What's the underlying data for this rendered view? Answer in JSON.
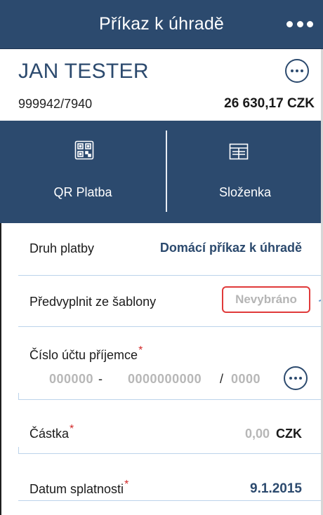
{
  "header": {
    "title": "Příkaz k úhradě",
    "more_icon": "more-horizontal-icon"
  },
  "account": {
    "name": "JAN TESTER",
    "number": "999942/7940",
    "balance": "26 630,17 CZK",
    "options_icon": "more-circle-icon"
  },
  "actions": [
    {
      "label": "QR Platba",
      "icon": "qr-code-icon"
    },
    {
      "label": "Složenka",
      "icon": "payment-slip-icon"
    }
  ],
  "form": {
    "payment_type": {
      "label": "Druh platby",
      "value": "Domácí příkaz k úhradě"
    },
    "template": {
      "label": "Předvyplnit ze šablony",
      "value": "Nevybráno"
    },
    "recipient_account": {
      "label": "Číslo účtu příjemce",
      "required_mark": "*",
      "prefix_placeholder": "000000",
      "prefix_separator": "-",
      "number_placeholder": "0000000000",
      "bank_separator": "/",
      "bank_placeholder": "0000"
    },
    "amount": {
      "label": "Částka",
      "required_mark": "*",
      "value": "0,00",
      "currency": "CZK"
    },
    "due_date": {
      "label": "Datum splatnosti",
      "required_mark": "*",
      "value": "9.1.2015"
    }
  },
  "colors": {
    "brand": "#2c4a6e",
    "required": "#d22a2a",
    "highlight_border": "#e03a3a",
    "placeholder": "#b7b7b7"
  }
}
